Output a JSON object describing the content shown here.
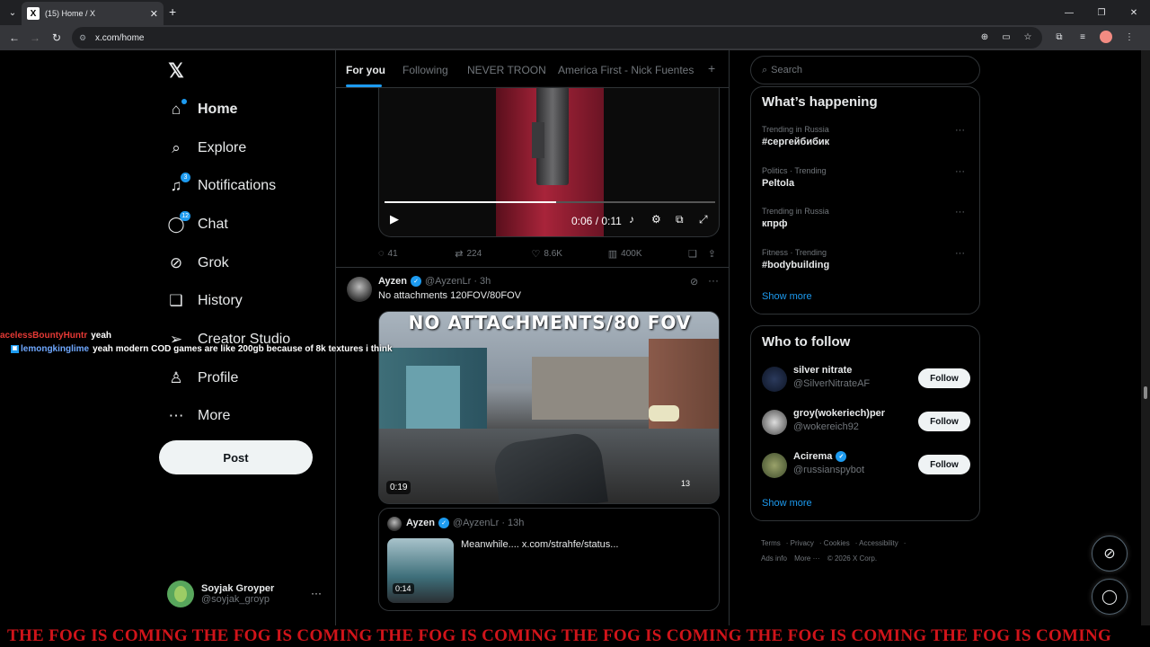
{
  "browser": {
    "tab_title": "(15) Home / X",
    "url": "x.com/home",
    "close_tab": "✕",
    "new_tab": "+",
    "window_controls": [
      "—",
      "❐",
      "✕"
    ]
  },
  "sidebar": {
    "logo": "𝕏",
    "items": [
      {
        "label": "Home",
        "icon": "home-icon"
      },
      {
        "label": "Explore",
        "icon": "search-icon"
      },
      {
        "label": "Notifications",
        "icon": "bell-icon",
        "badge": "3"
      },
      {
        "label": "Chat",
        "icon": "chat-icon",
        "badge": "12"
      },
      {
        "label": "Grok",
        "icon": "grok-icon"
      },
      {
        "label": "History",
        "icon": "bookmark-icon"
      },
      {
        "label": "Creator Studio",
        "icon": "send-icon"
      },
      {
        "label": "Profile",
        "icon": "person-icon"
      },
      {
        "label": "More",
        "icon": "more-circle-icon"
      }
    ],
    "post_label": "Post",
    "account": {
      "name": "Soyjak Groyper",
      "handle": "@soyjak_groyp"
    }
  },
  "chat_overlay": [
    {
      "user": "aceless​BountyHuntr",
      "message": "yeah"
    },
    {
      "user": "lemongkinglime",
      "message": "yeah modern COD games are like 200gb because of 8k textures i think"
    }
  ],
  "feed": {
    "tabs": [
      "For you",
      "Following",
      "NEVER TROON",
      "America First - Nick Fuentes"
    ],
    "add_tab": "+",
    "tweet1": {
      "video_time": "0:06 / 0:11",
      "progress": 0.52,
      "replies": "41",
      "reposts": "224",
      "likes": "8.6K",
      "views": "400K"
    },
    "tweet2": {
      "name": "Ayzen",
      "handle": "@AyzenLr",
      "time": "· 3h",
      "text": "No attachments 120FOV/80FOV",
      "video_overlay": "NO ATTACHMENTS/80 FOV",
      "video_duration": "0:19",
      "hud_ammo": "13",
      "quote": {
        "name": "Ayzen",
        "handle": "@AyzenLr",
        "time": "· 13h",
        "text": "Meanwhile.... x.com/strahfe/status...",
        "thumb_time": "0:14"
      }
    }
  },
  "right": {
    "search_placeholder": "Search",
    "happening_title": "What’s happening",
    "trends": [
      {
        "meta": "Trending in Russia",
        "name": "#сергейбибик"
      },
      {
        "meta": "Politics · Trending",
        "name": "Peltola"
      },
      {
        "meta": "Trending in Russia",
        "name": "кпрф"
      },
      {
        "meta": "Fitness · Trending",
        "name": "#bodybuilding"
      }
    ],
    "show_more": "Show more",
    "who_title": "Who to follow",
    "follow": [
      {
        "name": "silver nitrate",
        "handle": "@SilverNitrateAF",
        "verified": false
      },
      {
        "name": "groy(wokeriech)per",
        "handle": "@wokereich92",
        "verified": false
      },
      {
        "name": "Acirema",
        "handle": "@russianspybot",
        "verified": true
      }
    ],
    "follow_label": "Follow",
    "footer": [
      "Terms",
      "Privacy",
      "Cookies",
      "Accessibility",
      "Ads info",
      "More ···",
      "© 2026 X Corp."
    ]
  },
  "banner": "THE FOG IS COMING THE FOG IS COMING THE FOG IS COMING THE FOG IS COMING THE FOG IS COMING THE FOG IS COMING",
  "colors": {
    "accent": "#1d9bf0",
    "banner": "#d0141a",
    "chat_red": "#e53935"
  }
}
